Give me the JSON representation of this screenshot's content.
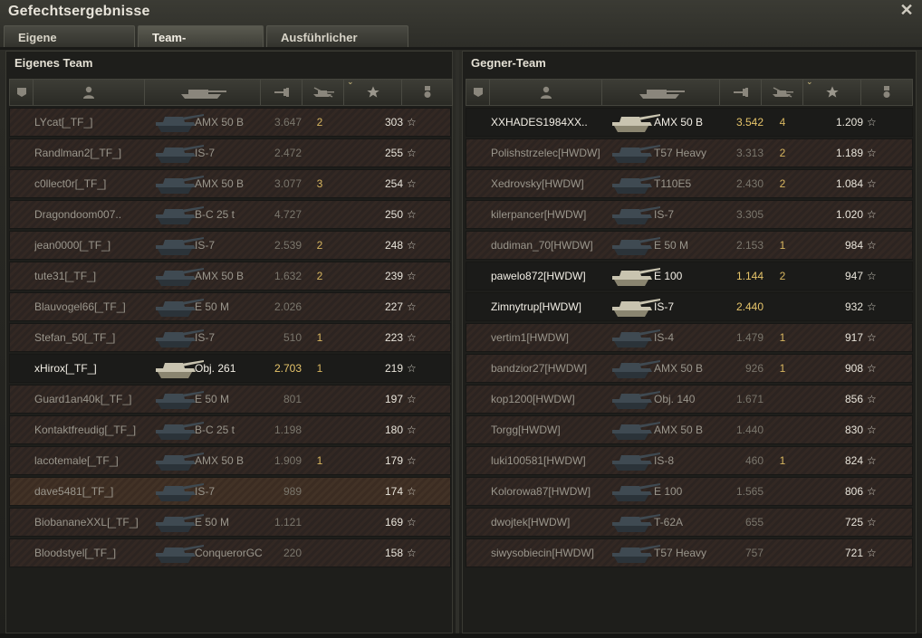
{
  "window": {
    "title": "Gefechtsergebnisse",
    "close_icon": "close-icon"
  },
  "tabs": [
    {
      "label": "Eigene Auswertung",
      "active": false
    },
    {
      "label": "Team-Auswertung",
      "active": true
    },
    {
      "label": "Ausführlicher Bericht",
      "active": false
    }
  ],
  "columns": {
    "icons": [
      "platoon-icon",
      "player-icon",
      "tank-icon",
      "damage-icon",
      "kills-icon",
      "xp-star-icon",
      "medal-icon"
    ],
    "sorted_by": "xp-star-icon"
  },
  "own_team": {
    "title": "Eigenes Team",
    "rows": [
      {
        "player": "LYcat[_TF_]",
        "tank": "AMX 50 B",
        "damage": "3.647",
        "kills": "2",
        "xp": "303",
        "state": "dead"
      },
      {
        "player": "Randlman2[_TF_]",
        "tank": "IS-7",
        "damage": "2.472",
        "kills": "",
        "xp": "255",
        "state": "dead"
      },
      {
        "player": "c0llect0r[_TF_]",
        "tank": "AMX 50 B",
        "damage": "3.077",
        "kills": "3",
        "xp": "254",
        "state": "dead"
      },
      {
        "player": "Dragondoom007..",
        "tank": "B-C 25 t",
        "damage": "4.727",
        "kills": "",
        "xp": "250",
        "state": "dead"
      },
      {
        "player": "jean0000[_TF_]",
        "tank": "IS-7",
        "damage": "2.539",
        "kills": "2",
        "xp": "248",
        "state": "dead"
      },
      {
        "player": "tute31[_TF_]",
        "tank": "AMX 50 B",
        "damage": "1.632",
        "kills": "2",
        "xp": "239",
        "state": "dead"
      },
      {
        "player": "Blauvogel66[_TF_]",
        "tank": "E 50 M",
        "damage": "2.026",
        "kills": "",
        "xp": "227",
        "state": "dead"
      },
      {
        "player": "Stefan_50[_TF_]",
        "tank": "IS-7",
        "damage": "510",
        "kills": "1",
        "xp": "223",
        "state": "dead"
      },
      {
        "player": "xHirox[_TF_]",
        "tank": "Obj. 261",
        "damage": "2.703",
        "kills": "1",
        "xp": "219",
        "state": "alive"
      },
      {
        "player": "Guard1an40k[_TF_]",
        "tank": "E 50 M",
        "damage": "801",
        "kills": "",
        "xp": "197",
        "state": "dead"
      },
      {
        "player": "Kontaktfreudig[_TF_]",
        "tank": "B-C 25 t",
        "damage": "1.198",
        "kills": "",
        "xp": "180",
        "state": "dead"
      },
      {
        "player": "lacotemale[_TF_]",
        "tank": "AMX 50 B",
        "damage": "1.909",
        "kills": "1",
        "xp": "179",
        "state": "dead"
      },
      {
        "player": "dave5481[_TF_]",
        "tank": "IS-7",
        "damage": "989",
        "kills": "",
        "xp": "174",
        "state": "self"
      },
      {
        "player": "BiobananeXXL[_TF_]",
        "tank": "E 50 M",
        "damage": "1.121",
        "kills": "",
        "xp": "169",
        "state": "dead"
      },
      {
        "player": "Bloodstyel[_TF_]",
        "tank": "ConquerorGC",
        "damage": "220",
        "kills": "",
        "xp": "158",
        "state": "dead"
      }
    ]
  },
  "enemy_team": {
    "title": "Gegner-Team",
    "rows": [
      {
        "player": "XXHADES1984XX..",
        "tank": "AMX 50 B",
        "damage": "3.542",
        "kills": "4",
        "xp": "1.209",
        "state": "alive"
      },
      {
        "player": "Polishstrzelec[HWDW]",
        "tank": "T57 Heavy",
        "damage": "3.313",
        "kills": "2",
        "xp": "1.189",
        "state": "dead"
      },
      {
        "player": "Xedrovsky[HWDW]",
        "tank": "T110E5",
        "damage": "2.430",
        "kills": "2",
        "xp": "1.084",
        "state": "dead"
      },
      {
        "player": "kilerpancer[HWDW]",
        "tank": "IS-7",
        "damage": "3.305",
        "kills": "",
        "xp": "1.020",
        "state": "dead"
      },
      {
        "player": "dudiman_70[HWDW]",
        "tank": "E 50 M",
        "damage": "2.153",
        "kills": "1",
        "xp": "984",
        "state": "dead"
      },
      {
        "player": "pawelo872[HWDW]",
        "tank": "E 100",
        "damage": "1.144",
        "kills": "2",
        "xp": "947",
        "state": "alive"
      },
      {
        "player": "Zimnytrup[HWDW]",
        "tank": "IS-7",
        "damage": "2.440",
        "kills": "",
        "xp": "932",
        "state": "alive"
      },
      {
        "player": "vertim1[HWDW]",
        "tank": "IS-4",
        "damage": "1.479",
        "kills": "1",
        "xp": "917",
        "state": "dead"
      },
      {
        "player": "bandzior27[HWDW]",
        "tank": "AMX 50 B",
        "damage": "926",
        "kills": "1",
        "xp": "908",
        "state": "dead"
      },
      {
        "player": "kop1200[HWDW]",
        "tank": "Obj. 140",
        "damage": "1.671",
        "kills": "",
        "xp": "856",
        "state": "dead"
      },
      {
        "player": "Torgg[HWDW]",
        "tank": "AMX 50 B",
        "damage": "1.440",
        "kills": "",
        "xp": "830",
        "state": "dead"
      },
      {
        "player": "luki100581[HWDW]",
        "tank": "IS-8",
        "damage": "460",
        "kills": "1",
        "xp": "824",
        "state": "dead"
      },
      {
        "player": "Kolorowa87[HWDW]",
        "tank": "E 100",
        "damage": "1.565",
        "kills": "",
        "xp": "806",
        "state": "dead"
      },
      {
        "player": "dwojtek[HWDW]",
        "tank": "T-62A",
        "damage": "655",
        "kills": "",
        "xp": "725",
        "state": "dead"
      },
      {
        "player": "siwysobiecin[HWDW]",
        "tank": "T57 Heavy",
        "damage": "757",
        "kills": "",
        "xp": "721",
        "state": "dead"
      }
    ]
  },
  "colors": {
    "alive_text": "#f3efe6",
    "dead_text": "#9a968c",
    "xp_highlight": "#e6c46a",
    "kills": "#d8b660"
  }
}
